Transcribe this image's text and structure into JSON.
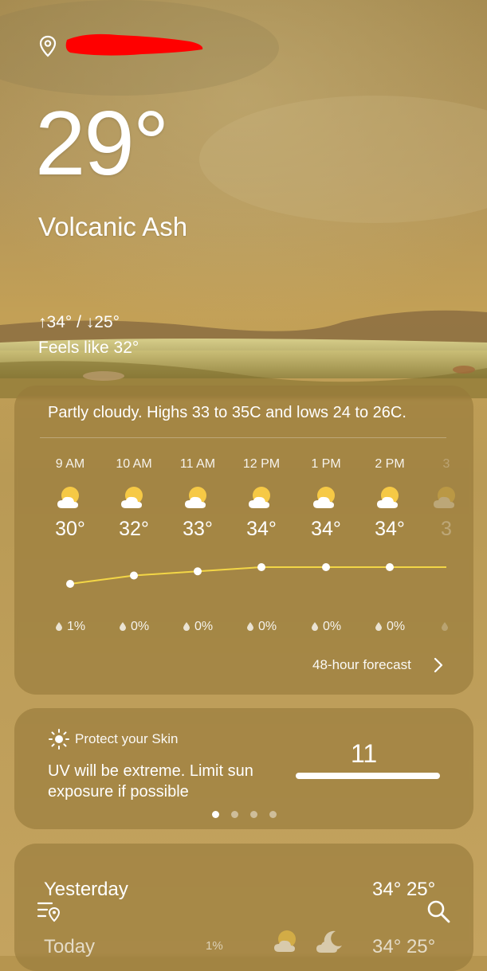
{
  "current": {
    "location": "",
    "temperature": "29°",
    "condition": "Volcanic Ash",
    "high_low": "↑34° / ↓25°",
    "feels_like": "Feels like 32°"
  },
  "summary": "Partly cloudy. Highs 33 to 35C and lows 24 to 26C.",
  "hourly": [
    {
      "time": "9 AM",
      "temp": "30°",
      "rain": "1%",
      "icon": "partly-cloudy-day-icon",
      "value": 30
    },
    {
      "time": "10 AM",
      "temp": "32°",
      "rain": "0%",
      "icon": "partly-cloudy-day-icon",
      "value": 32
    },
    {
      "time": "11 AM",
      "temp": "33°",
      "rain": "0%",
      "icon": "partly-cloudy-day-icon",
      "value": 33
    },
    {
      "time": "12 PM",
      "temp": "34°",
      "rain": "0%",
      "icon": "partly-cloudy-day-icon",
      "value": 34
    },
    {
      "time": "1 PM",
      "temp": "34°",
      "rain": "0%",
      "icon": "partly-cloudy-day-icon",
      "value": 34
    },
    {
      "time": "2 PM",
      "temp": "34°",
      "rain": "0%",
      "icon": "partly-cloudy-day-icon",
      "value": 34
    },
    {
      "time": "3",
      "temp": "3",
      "rain": "",
      "icon": "partly-cloudy-day-icon",
      "value": 34
    }
  ],
  "forecast_link": "48-hour forecast",
  "uv": {
    "title": "Protect your Skin",
    "message": "UV will be extreme. Limit sun exposure if possible",
    "value": "11",
    "page_count": 4,
    "active_page": 1
  },
  "daily": [
    {
      "label": "Yesterday",
      "temps": "34° 25°"
    },
    {
      "label": "Today",
      "rain": "1%",
      "temps": "34° 25°"
    }
  ],
  "colors": {
    "card": "#96793a",
    "temp_line": "#f3d646",
    "sun": "#f6c945",
    "redaction": "#ff0000"
  }
}
